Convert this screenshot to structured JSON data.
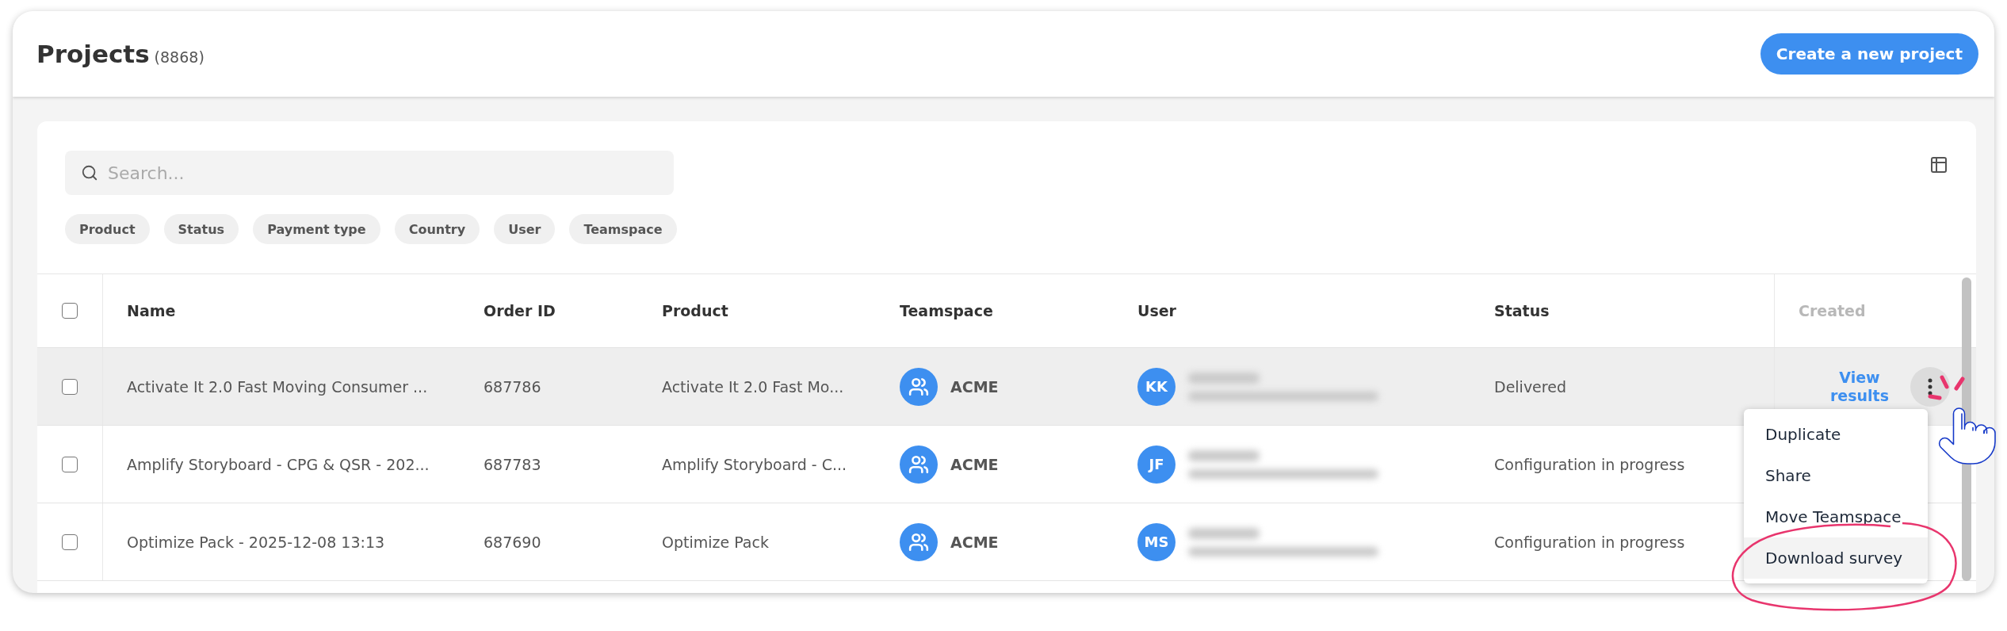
{
  "header": {
    "title": "Projects",
    "count": "(8868)",
    "create_button": "Create a new project"
  },
  "search": {
    "placeholder": "Search..."
  },
  "filters": [
    "Product",
    "Status",
    "Payment type",
    "Country",
    "User",
    "Teamspace"
  ],
  "table": {
    "select_all_checked": false,
    "columns": [
      {
        "label": "Name",
        "dimmed": false
      },
      {
        "label": "Order ID",
        "dimmed": false
      },
      {
        "label": "Product",
        "dimmed": false
      },
      {
        "label": "Teamspace",
        "dimmed": false
      },
      {
        "label": "User",
        "dimmed": false
      },
      {
        "label": "Status",
        "dimmed": false
      },
      {
        "label": "Created",
        "dimmed": true
      }
    ],
    "rows": [
      {
        "checked": false,
        "highlighted": true,
        "name": "Activate It 2.0 Fast Moving Consumer ...",
        "order_id": "687786",
        "product": "Activate It 2.0 Fast Mo...",
        "teamspace": "ACME",
        "user_initials": "KK",
        "status": "Delivered",
        "action": "View results",
        "menu_open": true
      },
      {
        "checked": false,
        "highlighted": false,
        "name": "Amplify Storyboard - CPG & QSR - 202...",
        "order_id": "687783",
        "product": "Amplify Storyboard - C...",
        "teamspace": "ACME",
        "user_initials": "JF",
        "status": "Configuration in progress",
        "menu_open": false
      },
      {
        "checked": false,
        "highlighted": false,
        "name": "Optimize Pack - 2025-12-08 13:13",
        "order_id": "687690",
        "product": "Optimize Pack",
        "teamspace": "ACME",
        "user_initials": "MS",
        "status": "Configuration in progress",
        "menu_open": false
      }
    ]
  },
  "menu": {
    "items": [
      {
        "label": "Duplicate",
        "highlighted": false
      },
      {
        "label": "Share",
        "highlighted": false
      },
      {
        "label": "Move Teamspace",
        "highlighted": false
      },
      {
        "label": "Download survey",
        "highlighted": true
      }
    ]
  }
}
